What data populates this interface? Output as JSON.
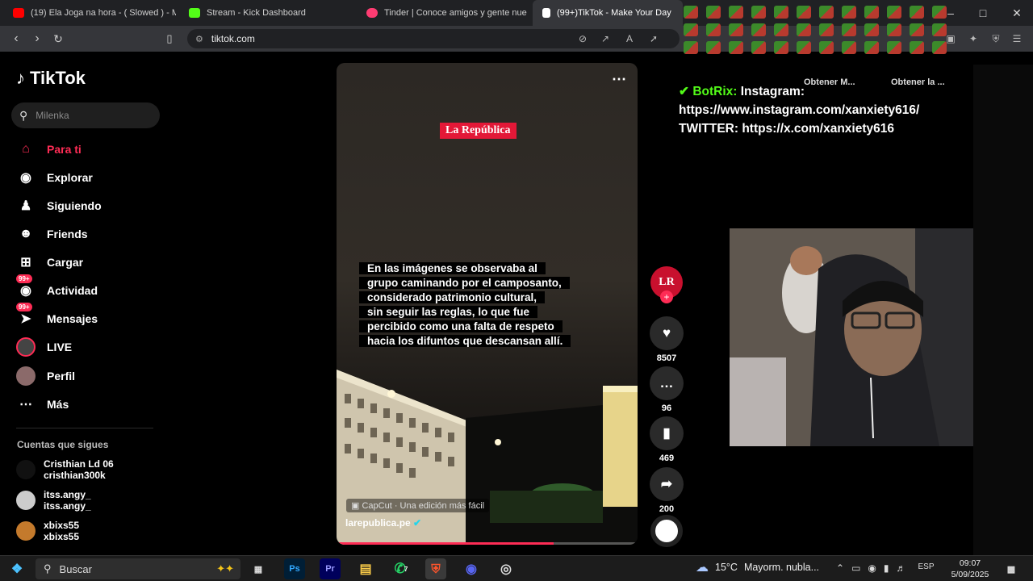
{
  "browser": {
    "tabs": [
      {
        "label": "(19) Ela Joga na hora - ( Slowed ) - M",
        "icon": "youtube-icon",
        "color": "#ff0000"
      },
      {
        "label": "Stream - Kick Dashboard",
        "icon": "kick-icon",
        "color": "#53fc18"
      },
      {
        "label": "Tinder | Conoce amigos y gente nue",
        "icon": "tinder-icon",
        "color": "#fe3c72"
      },
      {
        "label": "(99+)TikTok - Make Your Day",
        "icon": "tiktok-icon",
        "color": "#ffffff"
      }
    ],
    "url": "tiktok.com",
    "ext_obtener_1": "Obtener M...",
    "ext_obtener_2": "Obtener la ..."
  },
  "tiktok": {
    "brand": "TikTok",
    "search_placeholder": "Milenka",
    "nav": [
      {
        "label": "Para ti",
        "icon": "home-icon",
        "active": true
      },
      {
        "label": "Explorar",
        "icon": "compass-icon"
      },
      {
        "label": "Siguiendo",
        "icon": "following-icon"
      },
      {
        "label": "Friends",
        "icon": "friends-icon"
      },
      {
        "label": "Cargar",
        "icon": "upload-icon"
      },
      {
        "label": "Actividad",
        "icon": "activity-icon",
        "badge": "99+"
      },
      {
        "label": "Mensajes",
        "icon": "messages-icon",
        "badge": "99+"
      },
      {
        "label": "LIVE",
        "icon": "live-icon"
      },
      {
        "label": "Perfil",
        "icon": "profile-icon"
      },
      {
        "label": "Más",
        "icon": "more-icon"
      }
    ],
    "following_title": "Cuentas que sigues",
    "following": [
      {
        "name": "Cristhian Ld 06",
        "handle": "cristhian300k"
      },
      {
        "name": "itss.angy_",
        "handle": "itss.angy_"
      },
      {
        "name": "xbixs55",
        "handle": "xbixs55"
      }
    ],
    "video": {
      "brand_label": "La República",
      "caption_lines": [
        "En las imágenes se observaba al",
        "grupo caminando por el camposanto,",
        "considerado patrimonio cultural,",
        "sin seguir las reglas, lo que fue",
        "percibido como una falta de respeto",
        "hacia los difuntos que descansan allí."
      ],
      "capcut_label": "CapCut · Una edición más fácil",
      "author": "larepublica.pe",
      "progress": 0.72
    },
    "actions": {
      "avatar_text": "LR",
      "likes": "8507",
      "comments": "96",
      "saves": "469",
      "shares": "200"
    }
  },
  "stream_overlay": {
    "emote_count": 36,
    "bot_name": "BotRix:",
    "bot_line1": "Instagram:",
    "bot_line2": "https://www.instagram.com/xanxiety616/",
    "bot_line3": "TWITTER: https://x.com/xanxiety616"
  },
  "taskbar": {
    "search_placeholder": "Buscar",
    "apps": [
      "Ps",
      "Pr"
    ],
    "weather_temp": "15°C",
    "weather_desc": "Mayorm. nubla...",
    "lang": "ESP",
    "time": "09:07",
    "date": "5/09/2025",
    "whatsapp_badge": "7"
  }
}
